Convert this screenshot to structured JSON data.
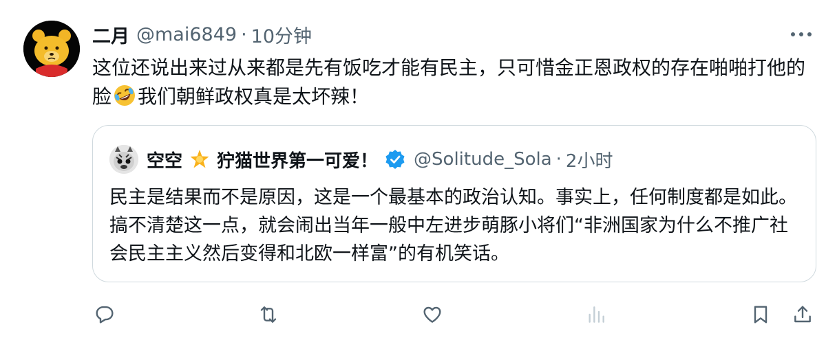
{
  "tweet": {
    "author_name": "二月",
    "handle": "@mai6849",
    "separator": "·",
    "time": "10分钟",
    "text_part1": "这位还说出来过从来都是先有饭吃才能有民主，只可惜金正恩政权的存在啪啪打他的脸",
    "emoji": "rolling-on-floor-laughing-emoji",
    "text_part2": "我们朝鲜政权真是太坏辣！"
  },
  "quote": {
    "author_name_part1": "空空",
    "author_name_part2": "狞猫世界第一可爱！",
    "star_icon": "glowing-star-emoji",
    "verified_icon": "verified-badge-icon",
    "handle": "@Solitude_Sola",
    "separator": "·",
    "time": "2小时",
    "text": "民主是结果而不是原因，这是一个最基本的政治认知。事实上，任何制度都是如此。搞不清楚这一点，就会闹出当年一般中左进步萌豚小将们“非洲国家为什么不推广社会民主主义然后变得和北欧一样富”的有机笑话。"
  },
  "actions": [
    "reply-icon",
    "retweet-icon",
    "like-icon",
    "views-icon",
    "bookmark-icon",
    "share-icon"
  ],
  "colors": {
    "text": "#0f1419",
    "secondary": "#536471",
    "border": "#cfd9de",
    "verified": "#1d9bf0"
  }
}
